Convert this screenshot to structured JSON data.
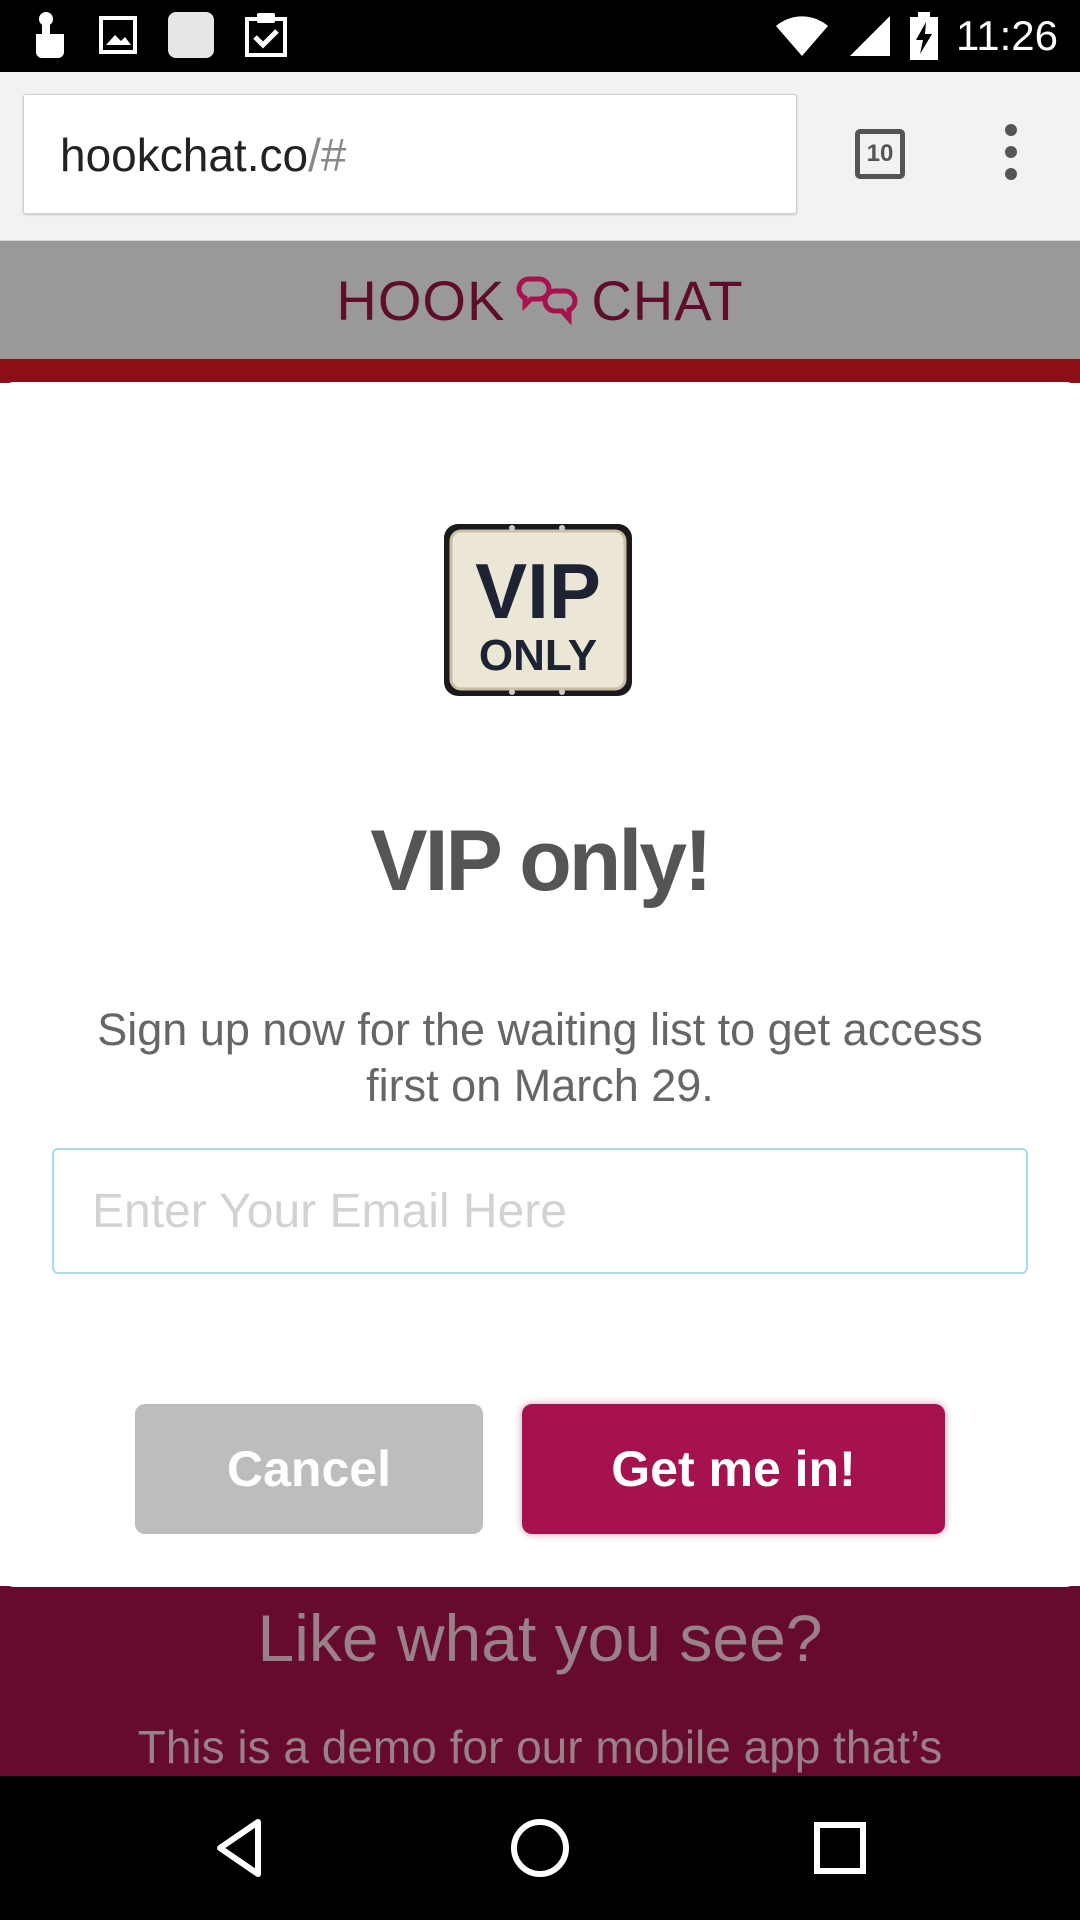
{
  "status_bar": {
    "time": "11:26",
    "left_icons": [
      "hand-touch-icon",
      "image-icon",
      "app-square-icon",
      "clipboard-check-icon"
    ],
    "right_icons": [
      "wifi-icon",
      "cell-signal-icon",
      "battery-charging-icon"
    ]
  },
  "browser": {
    "url_host": "hookchat.co",
    "url_path": "/#",
    "tab_count": "10",
    "menu_icon": "more-vert-icon"
  },
  "site": {
    "logo_left": "HOOK",
    "logo_right": "CHAT",
    "brand_color": "#5e0d2c",
    "header_bg": "#999999"
  },
  "modal": {
    "sign_line1": "VIP",
    "sign_line2": "ONLY",
    "title": "VIP only!",
    "description": "Sign up now for the waiting list to get access first on March 29.",
    "email_placeholder": "Enter Your Email Here",
    "email_value": "",
    "cancel_label": "Cancel",
    "submit_label": "Get me in!",
    "accent_color": "#a6124e"
  },
  "promo": {
    "title": "Like what you see?",
    "text": "This is a demo for our mobile app that’s"
  },
  "nav": {
    "items": [
      "back-icon",
      "home-icon",
      "recents-icon"
    ]
  }
}
